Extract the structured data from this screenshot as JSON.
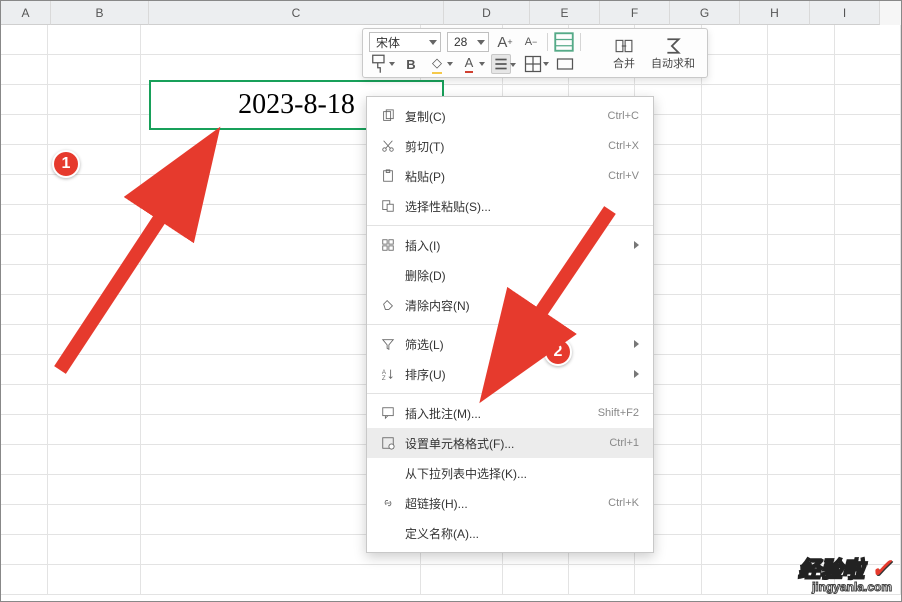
{
  "columns": [
    "A",
    "B",
    "C",
    "D",
    "E",
    "F",
    "G",
    "H",
    "I"
  ],
  "col_widths": [
    "wA",
    "wB",
    "wC",
    "wD",
    "wE",
    "wF",
    "wG",
    "wH",
    "wI",
    "wJ"
  ],
  "selected_cell_value": "2023-8-18",
  "minibar": {
    "font_name": "宋体",
    "font_size": "28",
    "merge_label": "合并",
    "autosum_label": "自动求和"
  },
  "context_menu": [
    {
      "type": "item",
      "icon": "copy-icon",
      "label": "复制(C)",
      "shortcut": "Ctrl+C"
    },
    {
      "type": "item",
      "icon": "cut-icon",
      "label": "剪切(T)",
      "shortcut": "Ctrl+X"
    },
    {
      "type": "item",
      "icon": "paste-icon",
      "label": "粘贴(P)",
      "shortcut": "Ctrl+V"
    },
    {
      "type": "item",
      "icon": "paste-special-icon",
      "label": "选择性粘贴(S)..."
    },
    {
      "type": "sep"
    },
    {
      "type": "item",
      "icon": "insert-icon",
      "label": "插入(I)",
      "submenu": true
    },
    {
      "type": "item",
      "icon": "",
      "label": "删除(D)"
    },
    {
      "type": "item",
      "icon": "clear-icon",
      "label": "清除内容(N)"
    },
    {
      "type": "sep"
    },
    {
      "type": "item",
      "icon": "filter-icon",
      "label": "筛选(L)",
      "submenu": true
    },
    {
      "type": "item",
      "icon": "sort-icon",
      "label": "排序(U)",
      "submenu": true
    },
    {
      "type": "sep"
    },
    {
      "type": "item",
      "icon": "comment-icon",
      "label": "插入批注(M)...",
      "shortcut": "Shift+F2"
    },
    {
      "type": "item",
      "icon": "format-cells-icon",
      "label": "设置单元格格式(F)...",
      "shortcut": "Ctrl+1",
      "hover": true
    },
    {
      "type": "item",
      "icon": "",
      "label": "从下拉列表中选择(K)..."
    },
    {
      "type": "item",
      "icon": "hyperlink-icon",
      "label": "超链接(H)...",
      "shortcut": "Ctrl+K"
    },
    {
      "type": "item",
      "icon": "",
      "label": "定义名称(A)..."
    }
  ],
  "markers": {
    "one": "1",
    "two": "2"
  },
  "watermark": {
    "line1": "经验啦",
    "line2": "jingyanla.com"
  }
}
